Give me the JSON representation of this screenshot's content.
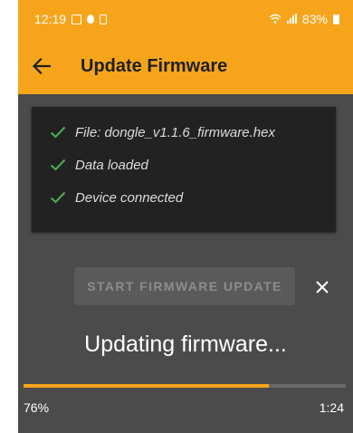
{
  "status_bar": {
    "time": "12:19",
    "battery": "83%",
    "icons": [
      "image-icon",
      "location-pin-icon",
      "clipboard-icon",
      "wifi-icon",
      "signal-icon",
      "battery-icon"
    ]
  },
  "app_bar": {
    "title": "Update Firmware",
    "back_icon": "back-arrow-icon"
  },
  "checks": [
    {
      "label": "File:  dongle_v1.1.6_firmware.hex",
      "icon": "check-icon"
    },
    {
      "label": "Data loaded",
      "icon": "check-icon"
    },
    {
      "label": "Device connected",
      "icon": "check-icon"
    }
  ],
  "start_button": {
    "label": "START FIRMWARE UPDATE",
    "enabled": false
  },
  "close_icon": "close-icon",
  "status_text": "Updating firmware...",
  "progress": {
    "fraction": 0.76,
    "percent_label": "76%",
    "time_label": "1:24"
  },
  "colors": {
    "accent": "#f6a51b",
    "background": "#4b4b4b",
    "card": "#222222",
    "check": "#4caf50"
  }
}
